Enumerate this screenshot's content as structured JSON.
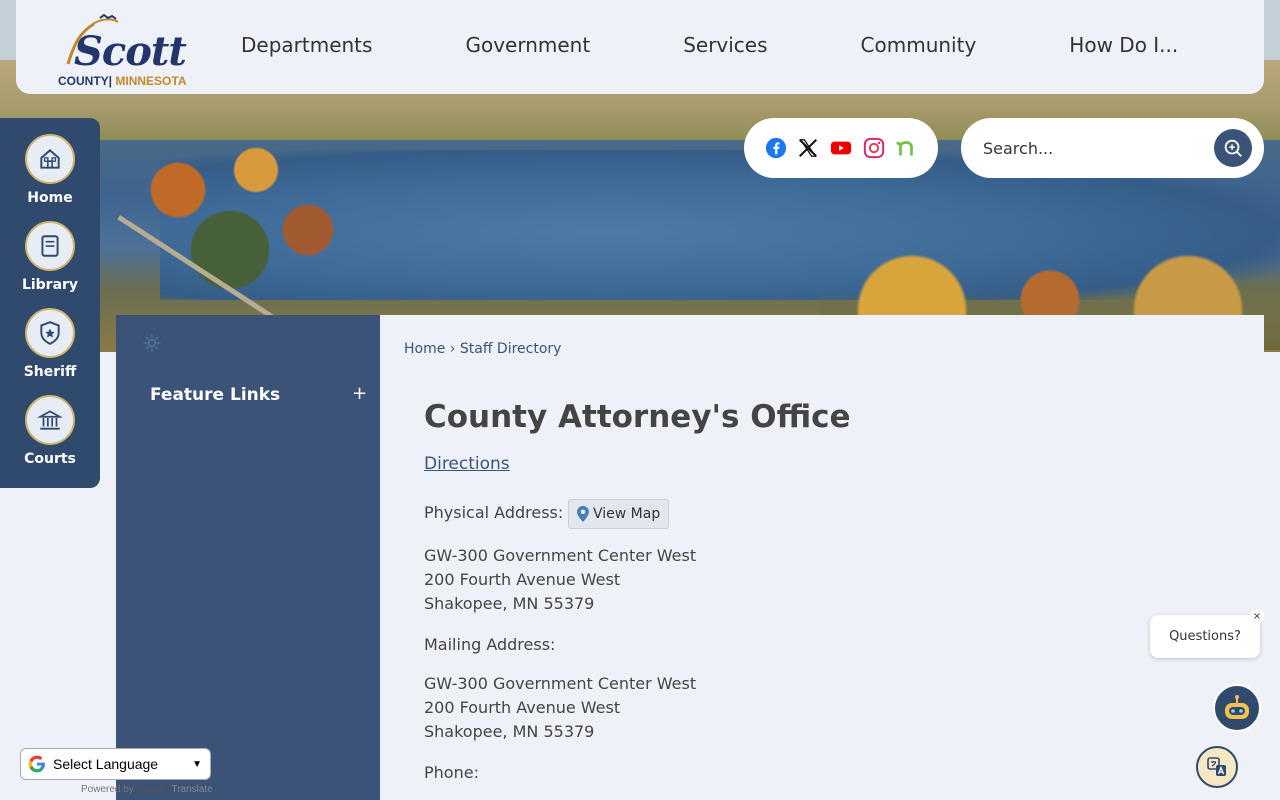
{
  "header": {
    "logo_word": "Scott",
    "logo_county": "COUNTY",
    "logo_state": "MINNESOTA",
    "nav": [
      "Departments",
      "Government",
      "Services",
      "Community",
      "How Do I..."
    ]
  },
  "social": [
    "facebook-icon",
    "x-icon",
    "youtube-icon",
    "instagram-icon",
    "nextdoor-icon"
  ],
  "search": {
    "placeholder": "Search..."
  },
  "quick_links": [
    {
      "label": "Home",
      "icon": "home-icon"
    },
    {
      "label": "Library",
      "icon": "book-icon"
    },
    {
      "label": "Sheriff",
      "icon": "badge-icon"
    },
    {
      "label": "Courts",
      "icon": "courthouse-icon"
    }
  ],
  "side": {
    "feature_links": "Feature Links",
    "plus": "+"
  },
  "breadcrumb": {
    "home": "Home",
    "sep": "›",
    "current": "Staff Directory"
  },
  "content": {
    "title": "County Attorney's Office",
    "directions": "Directions",
    "physical_label": "Physical Address:",
    "view_map": "View Map",
    "physical_address": [
      "GW-300 Government Center West",
      "200 Fourth Avenue West",
      "Shakopee, MN 55379"
    ],
    "mailing_label": "Mailing Address:",
    "mailing_address": [
      "GW-300 Government Center West",
      "200 Fourth Avenue West",
      "Shakopee, MN 55379"
    ],
    "phone_label": "Phone:"
  },
  "widgets": {
    "questions": "Questions?",
    "close": "×"
  },
  "language": {
    "select": "Select Language",
    "powered_by": "Powered by",
    "google": "Google",
    "translate": "Translate"
  }
}
